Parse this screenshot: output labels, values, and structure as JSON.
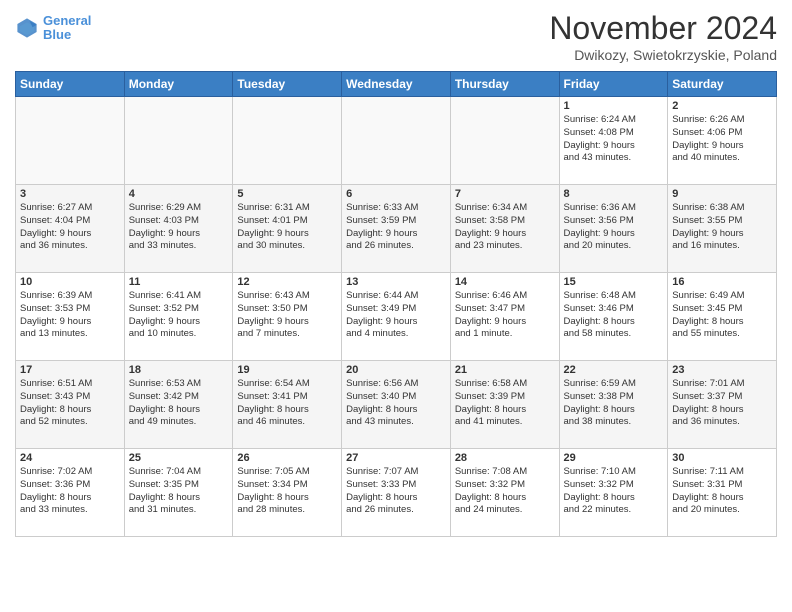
{
  "header": {
    "logo_line1": "General",
    "logo_line2": "Blue",
    "month": "November 2024",
    "location": "Dwikozy, Swietokrzyskie, Poland"
  },
  "weekdays": [
    "Sunday",
    "Monday",
    "Tuesday",
    "Wednesday",
    "Thursday",
    "Friday",
    "Saturday"
  ],
  "weeks": [
    [
      {
        "day": "",
        "info": ""
      },
      {
        "day": "",
        "info": ""
      },
      {
        "day": "",
        "info": ""
      },
      {
        "day": "",
        "info": ""
      },
      {
        "day": "",
        "info": ""
      },
      {
        "day": "1",
        "info": "Sunrise: 6:24 AM\nSunset: 4:08 PM\nDaylight: 9 hours\nand 43 minutes."
      },
      {
        "day": "2",
        "info": "Sunrise: 6:26 AM\nSunset: 4:06 PM\nDaylight: 9 hours\nand 40 minutes."
      }
    ],
    [
      {
        "day": "3",
        "info": "Sunrise: 6:27 AM\nSunset: 4:04 PM\nDaylight: 9 hours\nand 36 minutes."
      },
      {
        "day": "4",
        "info": "Sunrise: 6:29 AM\nSunset: 4:03 PM\nDaylight: 9 hours\nand 33 minutes."
      },
      {
        "day": "5",
        "info": "Sunrise: 6:31 AM\nSunset: 4:01 PM\nDaylight: 9 hours\nand 30 minutes."
      },
      {
        "day": "6",
        "info": "Sunrise: 6:33 AM\nSunset: 3:59 PM\nDaylight: 9 hours\nand 26 minutes."
      },
      {
        "day": "7",
        "info": "Sunrise: 6:34 AM\nSunset: 3:58 PM\nDaylight: 9 hours\nand 23 minutes."
      },
      {
        "day": "8",
        "info": "Sunrise: 6:36 AM\nSunset: 3:56 PM\nDaylight: 9 hours\nand 20 minutes."
      },
      {
        "day": "9",
        "info": "Sunrise: 6:38 AM\nSunset: 3:55 PM\nDaylight: 9 hours\nand 16 minutes."
      }
    ],
    [
      {
        "day": "10",
        "info": "Sunrise: 6:39 AM\nSunset: 3:53 PM\nDaylight: 9 hours\nand 13 minutes."
      },
      {
        "day": "11",
        "info": "Sunrise: 6:41 AM\nSunset: 3:52 PM\nDaylight: 9 hours\nand 10 minutes."
      },
      {
        "day": "12",
        "info": "Sunrise: 6:43 AM\nSunset: 3:50 PM\nDaylight: 9 hours\nand 7 minutes."
      },
      {
        "day": "13",
        "info": "Sunrise: 6:44 AM\nSunset: 3:49 PM\nDaylight: 9 hours\nand 4 minutes."
      },
      {
        "day": "14",
        "info": "Sunrise: 6:46 AM\nSunset: 3:47 PM\nDaylight: 9 hours\nand 1 minute."
      },
      {
        "day": "15",
        "info": "Sunrise: 6:48 AM\nSunset: 3:46 PM\nDaylight: 8 hours\nand 58 minutes."
      },
      {
        "day": "16",
        "info": "Sunrise: 6:49 AM\nSunset: 3:45 PM\nDaylight: 8 hours\nand 55 minutes."
      }
    ],
    [
      {
        "day": "17",
        "info": "Sunrise: 6:51 AM\nSunset: 3:43 PM\nDaylight: 8 hours\nand 52 minutes."
      },
      {
        "day": "18",
        "info": "Sunrise: 6:53 AM\nSunset: 3:42 PM\nDaylight: 8 hours\nand 49 minutes."
      },
      {
        "day": "19",
        "info": "Sunrise: 6:54 AM\nSunset: 3:41 PM\nDaylight: 8 hours\nand 46 minutes."
      },
      {
        "day": "20",
        "info": "Sunrise: 6:56 AM\nSunset: 3:40 PM\nDaylight: 8 hours\nand 43 minutes."
      },
      {
        "day": "21",
        "info": "Sunrise: 6:58 AM\nSunset: 3:39 PM\nDaylight: 8 hours\nand 41 minutes."
      },
      {
        "day": "22",
        "info": "Sunrise: 6:59 AM\nSunset: 3:38 PM\nDaylight: 8 hours\nand 38 minutes."
      },
      {
        "day": "23",
        "info": "Sunrise: 7:01 AM\nSunset: 3:37 PM\nDaylight: 8 hours\nand 36 minutes."
      }
    ],
    [
      {
        "day": "24",
        "info": "Sunrise: 7:02 AM\nSunset: 3:36 PM\nDaylight: 8 hours\nand 33 minutes."
      },
      {
        "day": "25",
        "info": "Sunrise: 7:04 AM\nSunset: 3:35 PM\nDaylight: 8 hours\nand 31 minutes."
      },
      {
        "day": "26",
        "info": "Sunrise: 7:05 AM\nSunset: 3:34 PM\nDaylight: 8 hours\nand 28 minutes."
      },
      {
        "day": "27",
        "info": "Sunrise: 7:07 AM\nSunset: 3:33 PM\nDaylight: 8 hours\nand 26 minutes."
      },
      {
        "day": "28",
        "info": "Sunrise: 7:08 AM\nSunset: 3:32 PM\nDaylight: 8 hours\nand 24 minutes."
      },
      {
        "day": "29",
        "info": "Sunrise: 7:10 AM\nSunset: 3:32 PM\nDaylight: 8 hours\nand 22 minutes."
      },
      {
        "day": "30",
        "info": "Sunrise: 7:11 AM\nSunset: 3:31 PM\nDaylight: 8 hours\nand 20 minutes."
      }
    ]
  ]
}
